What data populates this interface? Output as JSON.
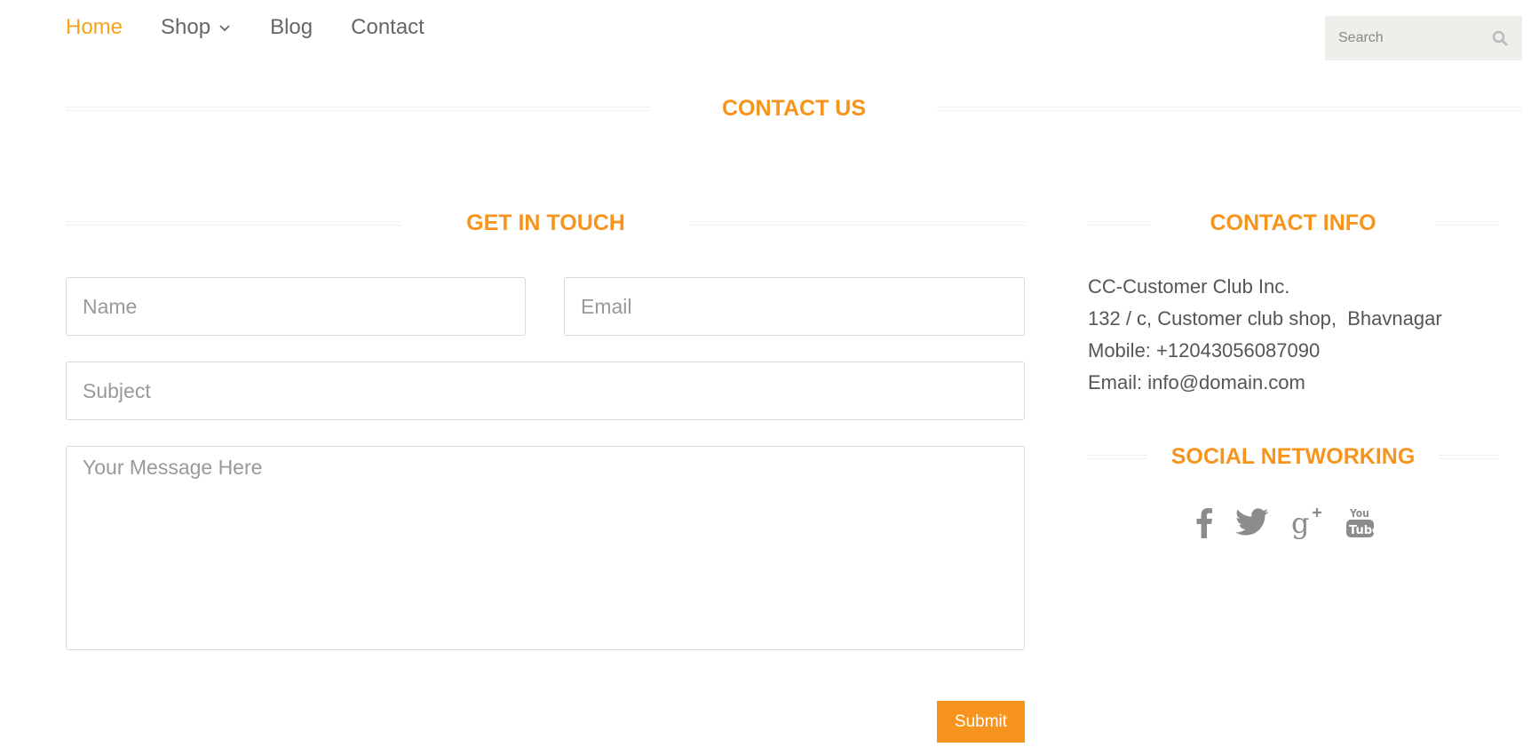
{
  "nav": {
    "home": "Home",
    "shop": "Shop",
    "blog": "Blog",
    "contact": "Contact"
  },
  "search": {
    "placeholder": "Search"
  },
  "page_title": "CONTACT US",
  "form": {
    "heading": "GET IN TOUCH",
    "name_placeholder": "Name",
    "email_placeholder": "Email",
    "subject_placeholder": "Subject",
    "message_placeholder": "Your Message Here",
    "submit_label": "Submit"
  },
  "contact_info": {
    "heading": "CONTACT INFO",
    "company": "CC-Customer Club Inc.",
    "address": "132 / c, Customer club shop,  Bhavnagar",
    "mobile": "Mobile: +12043056087090",
    "email": "Email: info@domain.com"
  },
  "social": {
    "heading": "SOCIAL NETWORKING",
    "icons": [
      "facebook-icon",
      "twitter-icon",
      "google-plus-icon",
      "youtube-icon"
    ]
  },
  "colors": {
    "accent": "#f7941d",
    "nav_active": "#f7a21b",
    "text": "#555555",
    "search_bg": "#efeeea"
  }
}
